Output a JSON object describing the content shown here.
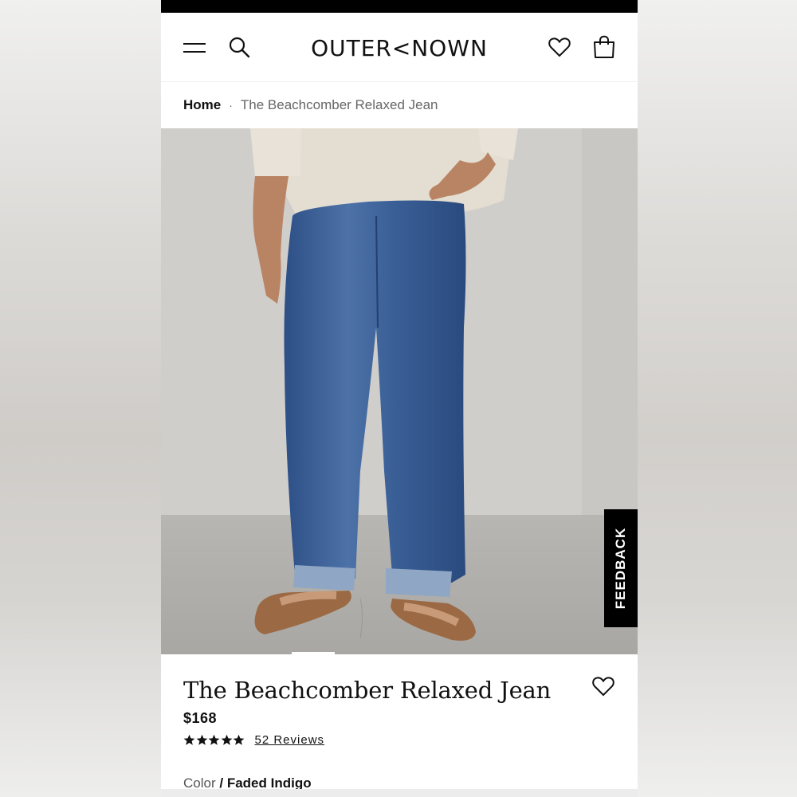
{
  "header": {
    "logo": "OUTERKNOWN",
    "logo_display": "OUTER<NOWN"
  },
  "breadcrumb": {
    "home": "Home",
    "separator": "·",
    "current": "The Beachcomber Relaxed Jean"
  },
  "feedback": {
    "label": "FEEDBACK"
  },
  "product": {
    "title": "The Beachcomber Relaxed Jean",
    "price": "$168",
    "rating": 5,
    "reviews_label": "52 Reviews",
    "color_label": "Color",
    "color_sep": "/",
    "color_value": "Faded Indigo"
  },
  "icons": [
    "menu-icon",
    "search-icon",
    "heart-icon",
    "bag-icon",
    "star-icon"
  ],
  "colors": {
    "header_bg": "#ffffff",
    "text": "#111111",
    "feedback_bg": "#000000",
    "status_bar": "#000000"
  }
}
